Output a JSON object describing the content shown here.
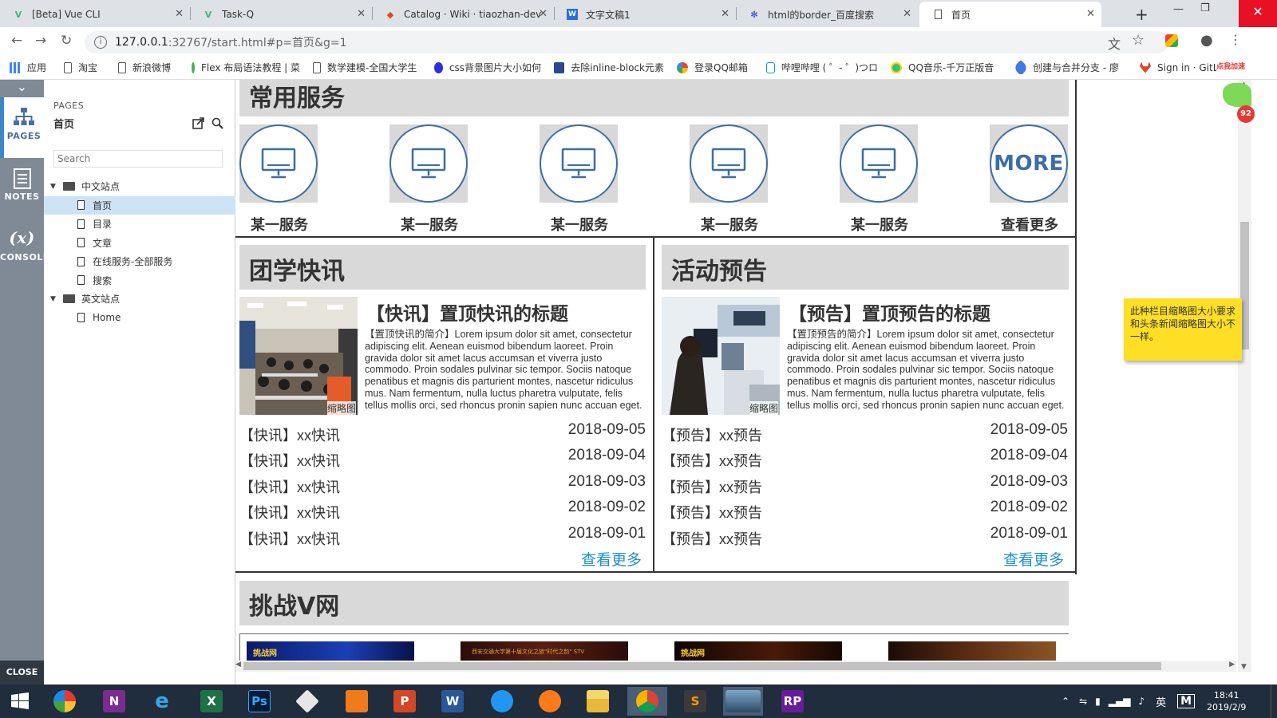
{
  "browser": {
    "tabs": [
      {
        "title": "[Beta] Vue CLI",
        "icon": "vue-icon"
      },
      {
        "title": "Task-Q",
        "icon": "vue-icon"
      },
      {
        "title": "Catalog · Wiki · tiaozhan-dev",
        "icon": "gitlab-icon"
      },
      {
        "title": "文字文稿1",
        "icon": "wps-doc-icon"
      },
      {
        "title": "html的border_百度搜索",
        "icon": "baidu-paw-icon"
      },
      {
        "title": "首页",
        "icon": "page-icon"
      }
    ],
    "url_host": "127.0.0.1",
    "url_rest": ":32767/start.html#p=首页&g=1",
    "bookmarks": [
      {
        "label": "应用",
        "icon": "apps-grid-icon"
      },
      {
        "label": "淘宝",
        "icon": "page-icon"
      },
      {
        "label": "新浪微博",
        "icon": "page-icon"
      },
      {
        "label": "Flex 布局语法教程 | 菜",
        "icon": "green-globe-icon"
      },
      {
        "label": "数学建模-全国大学生",
        "icon": "page-icon"
      },
      {
        "label": "css背景图片大小如何",
        "icon": "baidu-paw-icon"
      },
      {
        "label": "去除inline-block元素",
        "icon": "blue-square-icon"
      },
      {
        "label": "登录QQ邮箱",
        "icon": "qqmail-icon"
      },
      {
        "label": "哔哩哔哩 ( ゜- ゜)つロ",
        "icon": "bilibili-icon"
      },
      {
        "label": "QQ音乐-千万正版音",
        "icon": "qqmusic-icon"
      },
      {
        "label": "创建与合并分支 - 廖",
        "icon": "rocket-icon"
      },
      {
        "label": "Sign in · GitLab",
        "icon": "gitlab-icon"
      }
    ],
    "extension_badge": "点我加速",
    "extension_count": "92"
  },
  "axure": {
    "rail": {
      "pages_label": "PAGES",
      "notes_label": "NOTES",
      "console_label": "CONSOLE",
      "console_glyph": "(x)",
      "close_label": "CLOSE"
    },
    "pages_header": "PAGES",
    "current_page": "首页",
    "search_placeholder": "Search",
    "tree": [
      {
        "label": "中文站点",
        "type": "folder",
        "level": 0
      },
      {
        "label": "首页",
        "type": "page",
        "level": 1,
        "selected": true
      },
      {
        "label": "目录",
        "type": "page",
        "level": 1
      },
      {
        "label": "文章",
        "type": "page",
        "level": 1
      },
      {
        "label": "在线服务-全部服务",
        "type": "page",
        "level": 1
      },
      {
        "label": "搜索",
        "type": "page",
        "level": 1
      },
      {
        "label": "英文站点",
        "type": "folder",
        "level": 0
      },
      {
        "label": "Home",
        "type": "page",
        "level": 1
      }
    ]
  },
  "page": {
    "services_title": "常用服务",
    "services": [
      {
        "label": "某一服务",
        "icon": "monitor-icon"
      },
      {
        "label": "某一服务",
        "icon": "monitor-icon"
      },
      {
        "label": "某一服务",
        "icon": "monitor-icon"
      },
      {
        "label": "某一服务",
        "icon": "monitor-icon"
      },
      {
        "label": "某一服务",
        "icon": "monitor-icon"
      },
      {
        "label": "查看更多",
        "icon": "more-icon",
        "icon_text": "MORE"
      }
    ],
    "news": {
      "title": "团学快讯",
      "headline": "【快讯】置顶快讯的标题",
      "summary": "【置顶快讯的简介】Lorem ipsum dolor sit amet, consectetur adipiscing elit. Aenean euismod bibendum laoreet. Proin gravida dolor sit amet lacus accumsan et viverra justo commodo. Proin sodales pulvinar sic tempor. Sociis natoque penatibus et magnis dis parturient montes, nascetur ridiculus mus. Nam fermentum, nulla luctus pharetra vulputate, felis tellus mollis orci, sed rhoncus pronin sapien nunc accuan eget.",
      "thumb_caption": "缩略图",
      "items": [
        {
          "title": "【快讯】xx快讯",
          "date": "2018-09-05"
        },
        {
          "title": "【快讯】xx快讯",
          "date": "2018-09-04"
        },
        {
          "title": "【快讯】xx快讯",
          "date": "2018-09-03"
        },
        {
          "title": "【快讯】xx快讯",
          "date": "2018-09-02"
        },
        {
          "title": "【快讯】xx快讯",
          "date": "2018-09-01"
        }
      ],
      "more": "查看更多"
    },
    "events": {
      "title": "活动预告",
      "headline": "【预告】置顶预告的标题",
      "summary": "【置顶预告的简介】Lorem ipsum dolor sit amet, consectetur adipiscing elit. Aenean euismod bibendum laoreet. Proin gravida dolor sit amet lacus accumsan et viverra justo commodo. Proin sodales pulvinar sic tempor. Sociis natoque penatibus et magnis dis parturient montes, nascetur ridiculus mus. Nam fermentum, nulla luctus pharetra vulputate, felis tellus mollis orci, sed rhoncus pronin sapien nunc accuan eget.",
      "thumb_caption": "缩略图",
      "items": [
        {
          "title": "【预告】xx预告",
          "date": "2018-09-05"
        },
        {
          "title": "【预告】xx预告",
          "date": "2018-09-04"
        },
        {
          "title": "【预告】xx预告",
          "date": "2018-09-03"
        },
        {
          "title": "【预告】xx预告",
          "date": "2018-09-02"
        },
        {
          "title": "【预告】xx预告",
          "date": "2018-09-01"
        }
      ],
      "more": "查看更多"
    },
    "tzv_title": "挑战V网",
    "tzv_thumb_labels": [
      "挑战网",
      "西安交通大学第十届文化之旅\"时代之韵\" STV",
      "挑战网",
      ""
    ]
  },
  "sticky_note": "此种栏目缩略图大小要求和头条新闻缩略图大小不一样。",
  "taskbar": {
    "apps": [
      {
        "name": "windows-start-icon"
      },
      {
        "name": "photos-app-icon"
      },
      {
        "name": "onenote-icon",
        "text": "N"
      },
      {
        "name": "ie-icon",
        "text": "e"
      },
      {
        "name": "excel-icon",
        "text": "X"
      },
      {
        "name": "photoshop-icon",
        "text": "Ps"
      },
      {
        "name": "git-icon"
      },
      {
        "name": "music-app-icon"
      },
      {
        "name": "powerpoint-icon",
        "text": "P"
      },
      {
        "name": "word-icon",
        "text": "W"
      },
      {
        "name": "feather-app-icon"
      },
      {
        "name": "orange-app-icon"
      },
      {
        "name": "file-explorer-icon"
      },
      {
        "name": "chrome-icon"
      },
      {
        "name": "sublime-icon",
        "text": "S"
      },
      {
        "name": "ps-image-icon"
      },
      {
        "name": "axure-rp-icon",
        "text": "RP"
      }
    ],
    "ime": "英",
    "time": "18:41",
    "date": "2019/2/9"
  },
  "colors": {
    "accent_blue": "#3b6ea5",
    "link_blue": "#1d8fd2",
    "sticky": "#ffdf25",
    "rail": "#7f8a96"
  }
}
